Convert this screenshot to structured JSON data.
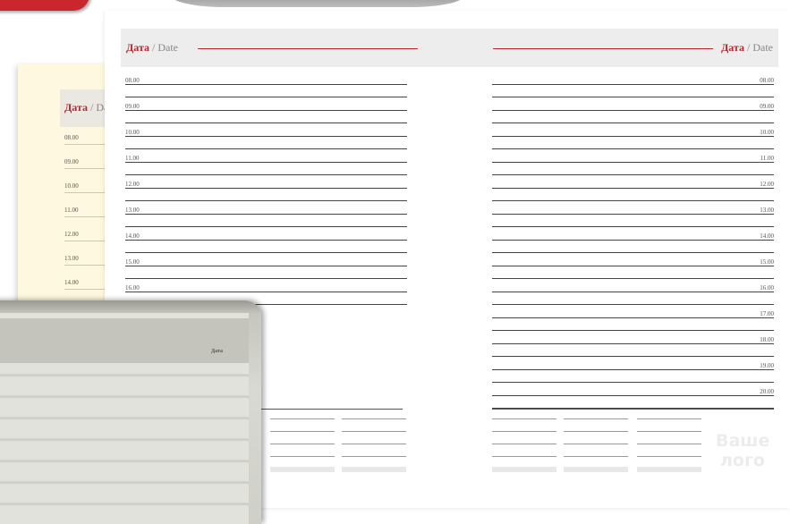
{
  "header": {
    "date_ru": "Дата",
    "date_sep_en": "/ Date",
    "date_ru_back": "Дата",
    "date_sep_en_back": "/ Da"
  },
  "left_page": {
    "times": [
      "08.00",
      "09.00",
      "10.00",
      "11.00",
      "12.00",
      "13.00",
      "14.00",
      "15.00",
      "16.00"
    ]
  },
  "right_page": {
    "times": [
      "08.00",
      "09.00",
      "10.00",
      "11.00",
      "12.00",
      "13.00",
      "14.00",
      "15.00",
      "16.00",
      "17.00",
      "18.00",
      "19.00",
      "20.00"
    ]
  },
  "back_page": {
    "times": [
      "08.00",
      "09.00",
      "10.00",
      "11.00",
      "12.00",
      "13.00",
      "14.00"
    ]
  },
  "notebook": {
    "label": "Дата"
  },
  "logo": {
    "line1": "Ваше",
    "line2": "лого"
  },
  "colors": {
    "accent": "#b3262e",
    "header_bg": "#ededed",
    "cream": "#fdf8df"
  }
}
